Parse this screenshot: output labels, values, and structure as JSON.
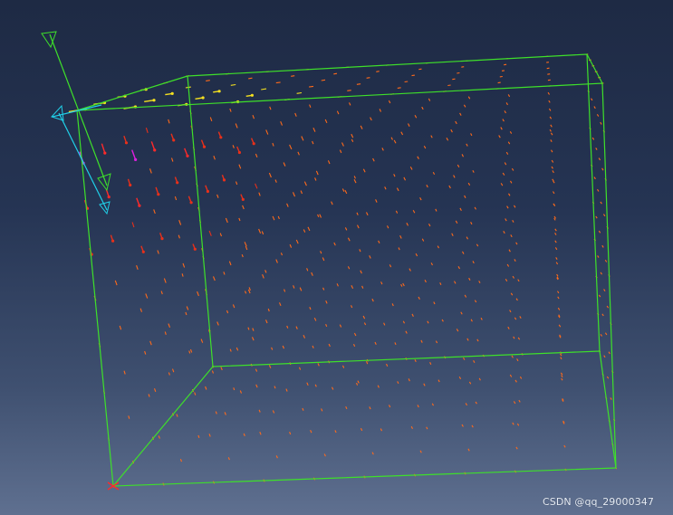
{
  "viewport": {
    "background_top": "#1e2a44",
    "background_bottom": "#5f7090",
    "box_edge_color": "#3ee02a",
    "vector_color_main": "#ff6a1a",
    "vector_color_mid": "#e8301a",
    "vector_color_high": "#ff2a2a",
    "vector_color_peak": "#e020e0",
    "vector_color_top_row": "#f4e020",
    "triad_axis_green": "#3ee02a",
    "triad_axis_cyan": "#20d0e8"
  },
  "watermark": {
    "text": "CSDN @qq_29000347"
  }
}
